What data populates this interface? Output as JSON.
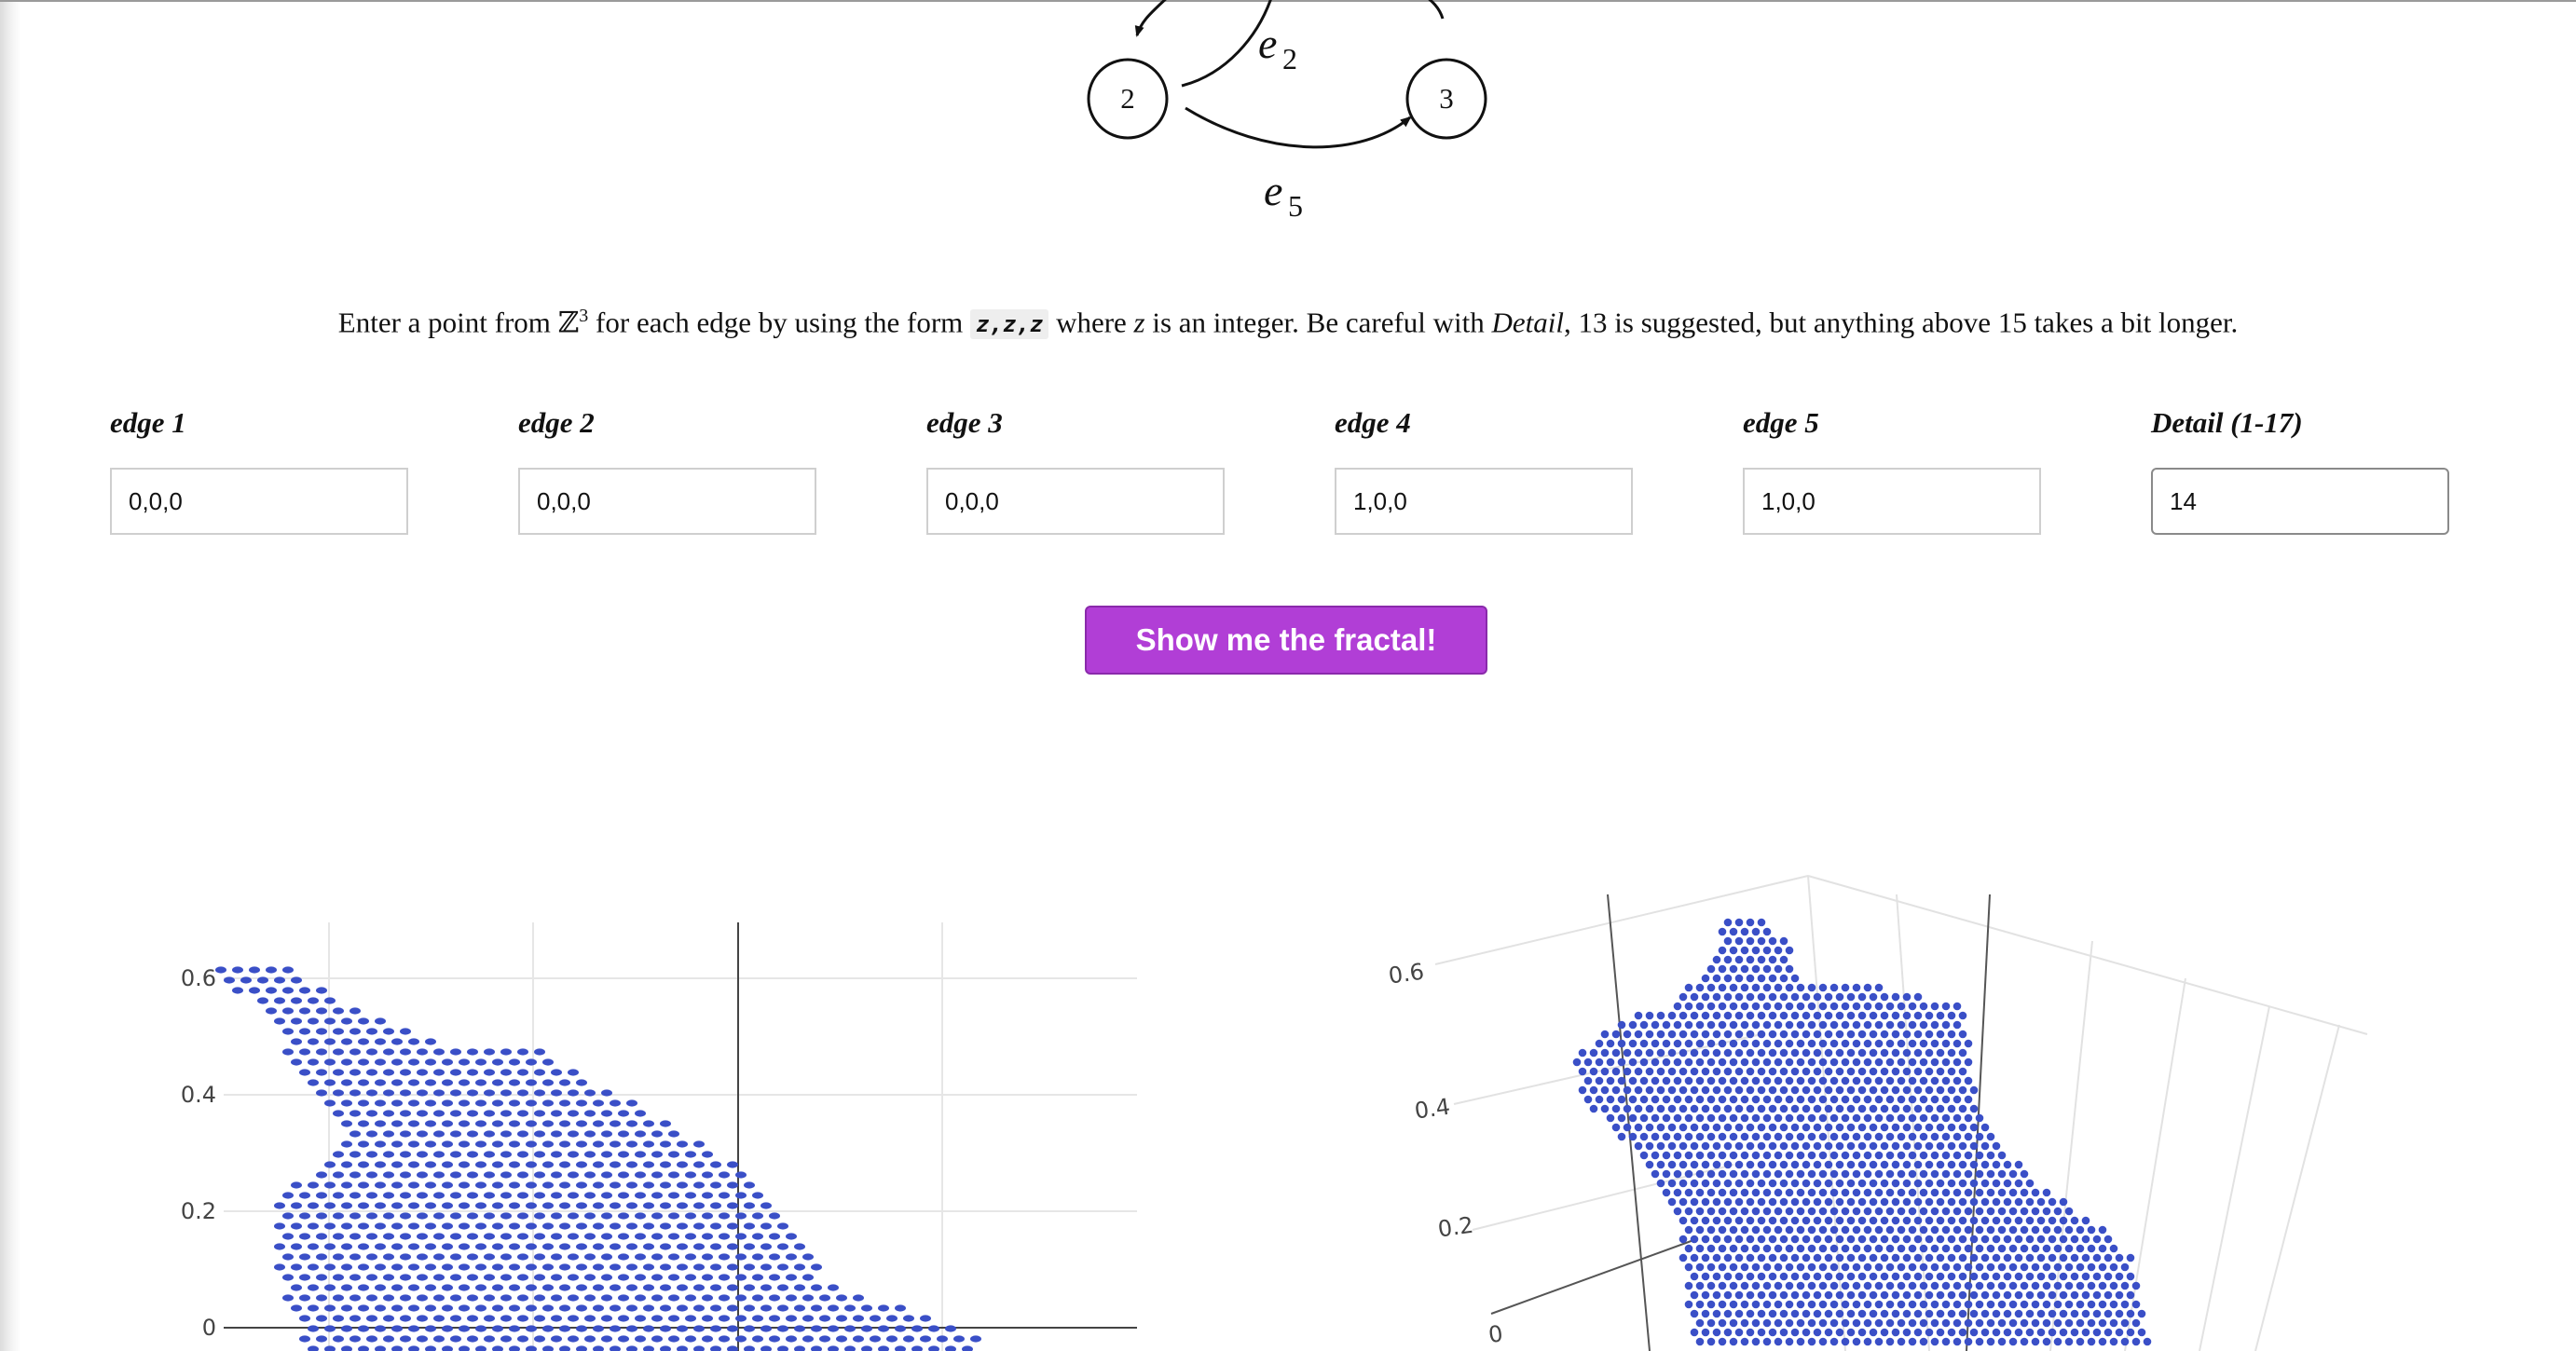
{
  "graph": {
    "nodes": [
      "2",
      "3"
    ],
    "edge_labels": [
      "e",
      "2",
      "e",
      "5"
    ]
  },
  "instructions": {
    "part1": "Enter a point from ",
    "set_symbol": "ℤ",
    "set_power": "3",
    "part2": " for each edge by using the form ",
    "form_code": "z,z,z",
    "part3": " where ",
    "var": "z",
    "part4": " is an integer. Be careful with ",
    "detail_word": "Detail",
    "part5": ", 13 is suggested, but anything above 15 takes a bit longer."
  },
  "inputs": [
    {
      "label": "edge 1",
      "value": "0,0,0"
    },
    {
      "label": "edge 2",
      "value": "0,0,0"
    },
    {
      "label": "edge 3",
      "value": "0,0,0"
    },
    {
      "label": "edge 4",
      "value": "1,0,0"
    },
    {
      "label": "edge 5",
      "value": "1,0,0"
    },
    {
      "label": "Detail (1-17)",
      "value": "14"
    }
  ],
  "button": {
    "label": "Show me the fractal!"
  },
  "colors": {
    "button": "#b13ed6",
    "points": "#3a4fc7",
    "grid": "#e6e6e6"
  },
  "plot_2d": {
    "y_ticks": [
      "0.6",
      "0.4",
      "0.2",
      "0"
    ]
  },
  "plot_3d": {
    "y_ticks": [
      "0.6",
      "0.4",
      "0.2",
      "0"
    ]
  }
}
